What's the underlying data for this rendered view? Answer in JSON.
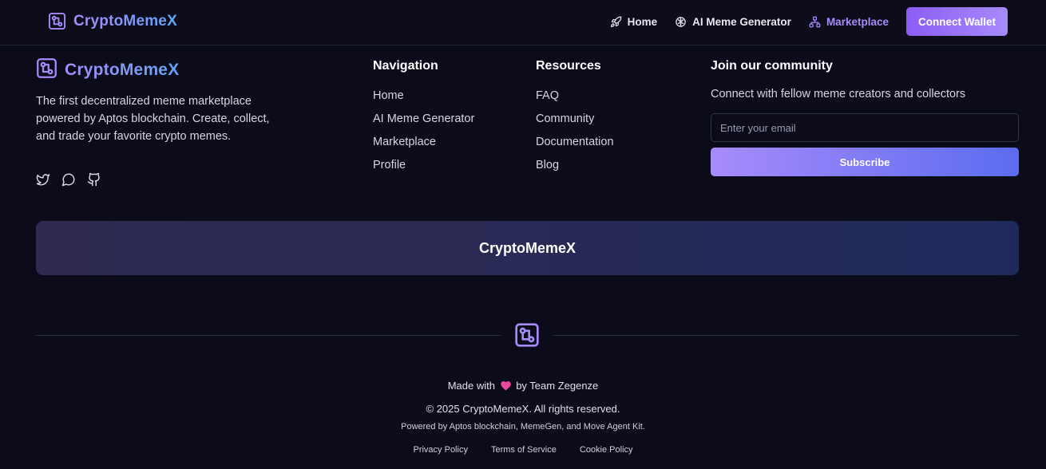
{
  "header": {
    "brand": "CryptoMemeX",
    "nav": [
      {
        "label": "Home",
        "icon": "rocket-icon"
      },
      {
        "label": "AI Meme Generator",
        "icon": "brain-icon"
      },
      {
        "label": "Marketplace",
        "icon": "network-icon",
        "active": true
      }
    ],
    "connect_label": "Connect Wallet"
  },
  "footer": {
    "brand": "CryptoMemeX",
    "description": "The first decentralized meme marketplace powered by Aptos blockchain. Create, collect, and trade your favorite crypto memes.",
    "socials": [
      "twitter-icon",
      "chat-icon",
      "github-icon"
    ],
    "navigation": {
      "title": "Navigation",
      "links": [
        "Home",
        "AI Meme Generator",
        "Marketplace",
        "Profile"
      ]
    },
    "resources": {
      "title": "Resources",
      "links": [
        "FAQ",
        "Community",
        "Documentation",
        "Blog"
      ]
    },
    "community": {
      "title": "Join our community",
      "text": "Connect with fellow meme creators and collectors",
      "email_placeholder": "Enter your email",
      "subscribe_label": "Subscribe"
    },
    "banner": "CryptoMemeX",
    "made_with_prefix": "Made with",
    "made_with_suffix": "by Team Zegenze",
    "copyright": "© 2025 CryptoMemeX. All rights reserved.",
    "powered": "Powered by Aptos blockchain, MemeGen, and Move Agent Kit.",
    "legal": [
      "Privacy Policy",
      "Terms of Service",
      "Cookie Policy"
    ]
  },
  "colors": {
    "background": "#0b0b1a",
    "accent": "#a78bfa",
    "heart": "#ec4899"
  }
}
